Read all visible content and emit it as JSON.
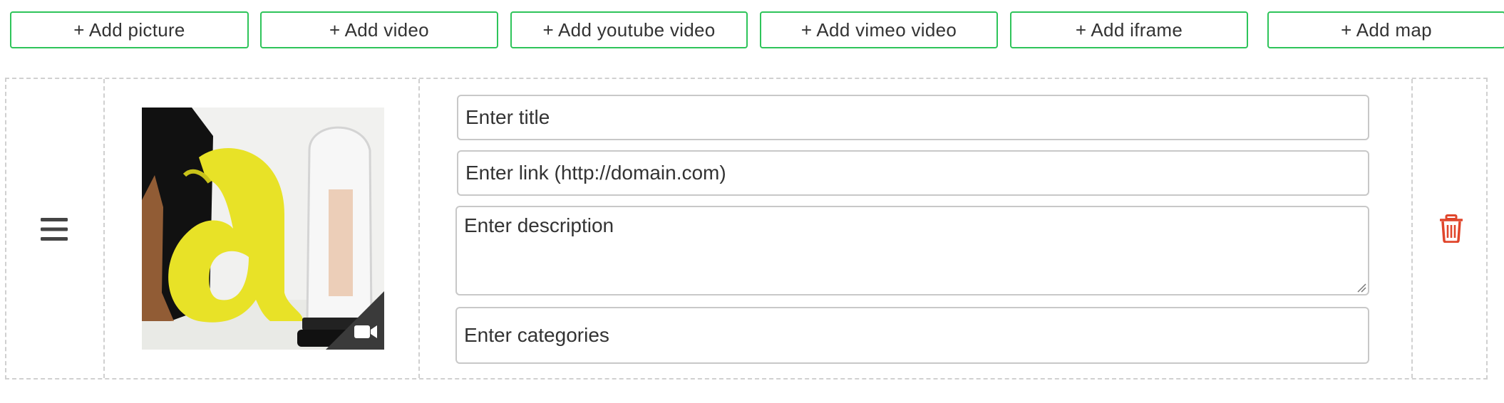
{
  "toolbar": {
    "buttons": [
      {
        "label": "+ Add picture"
      },
      {
        "label": "+ Add video"
      },
      {
        "label": "+ Add youtube video"
      },
      {
        "label": "+ Add vimeo video"
      },
      {
        "label": "+ Add iframe"
      },
      {
        "label": "+ Add map"
      }
    ]
  },
  "item": {
    "handle_icon": "hamburger-menu-icon",
    "thumbnail_icon": "video-camera-icon",
    "delete_icon": "trash-icon",
    "fields": {
      "title_placeholder": "Enter title",
      "link_placeholder": "Enter link (http://domain.com)",
      "description_placeholder": "Enter description",
      "categories_placeholder": "Enter categories"
    }
  },
  "colors": {
    "button_border": "#2ec45a",
    "delete_icon": "#e0452b",
    "handle_icon": "#444444"
  }
}
